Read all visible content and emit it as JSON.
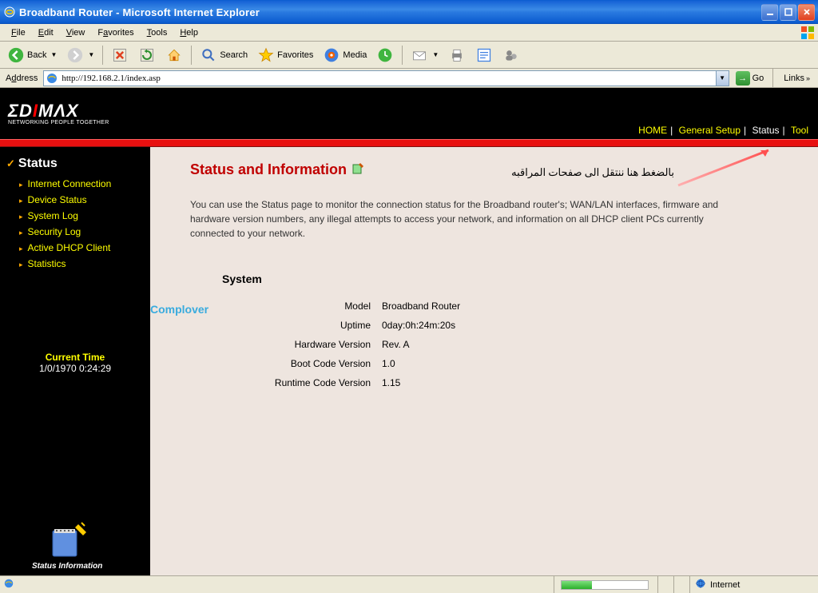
{
  "window": {
    "title": "Broadband Router - Microsoft Internet Explorer"
  },
  "menubar": [
    "File",
    "Edit",
    "View",
    "Favorites",
    "Tools",
    "Help"
  ],
  "toolbar": {
    "back": "Back",
    "search": "Search",
    "favorites": "Favorites",
    "media": "Media"
  },
  "addressbar": {
    "label": "Address",
    "url": "http://192.168.2.1/index.asp",
    "go": "Go",
    "links": "Links"
  },
  "logo": {
    "main": "ΣDIMΛX",
    "sub": "NETWORKING PEOPLE TOGETHER"
  },
  "topnav": {
    "home": "HOME",
    "general": "General Setup",
    "status": "Status",
    "tool": "Tool"
  },
  "sidebar": {
    "title": "Status",
    "items": [
      "Internet Connection",
      "Device Status",
      "System Log",
      "Security Log",
      "Active DHCP Client",
      "Statistics"
    ],
    "current_time_label": "Current Time",
    "current_time_value": "1/0/1970 0:24:29",
    "status_info": "Status Information"
  },
  "main": {
    "title": "Status and Information",
    "arabic_note": "بالضغط هنا ننتقل الى صفحات المراقبه",
    "desc": "You can use the Status page to monitor the connection status for the Broadband router's; WAN/LAN interfaces, firmware and hardware version numbers, any illegal attempts to access your network, and information on all DHCP client PCs currently connected to your network.",
    "section_title": "System",
    "watermark": "Complover",
    "rows": [
      {
        "label": "Model",
        "value": "Broadband Router"
      },
      {
        "label": "Uptime",
        "value": "0day:0h:24m:20s"
      },
      {
        "label": "Hardware Version",
        "value": "Rev. A"
      },
      {
        "label": "Boot Code Version",
        "value": "1.0"
      },
      {
        "label": "Runtime Code Version",
        "value": "1.15"
      }
    ]
  },
  "statusbar": {
    "zone": "Internet"
  }
}
